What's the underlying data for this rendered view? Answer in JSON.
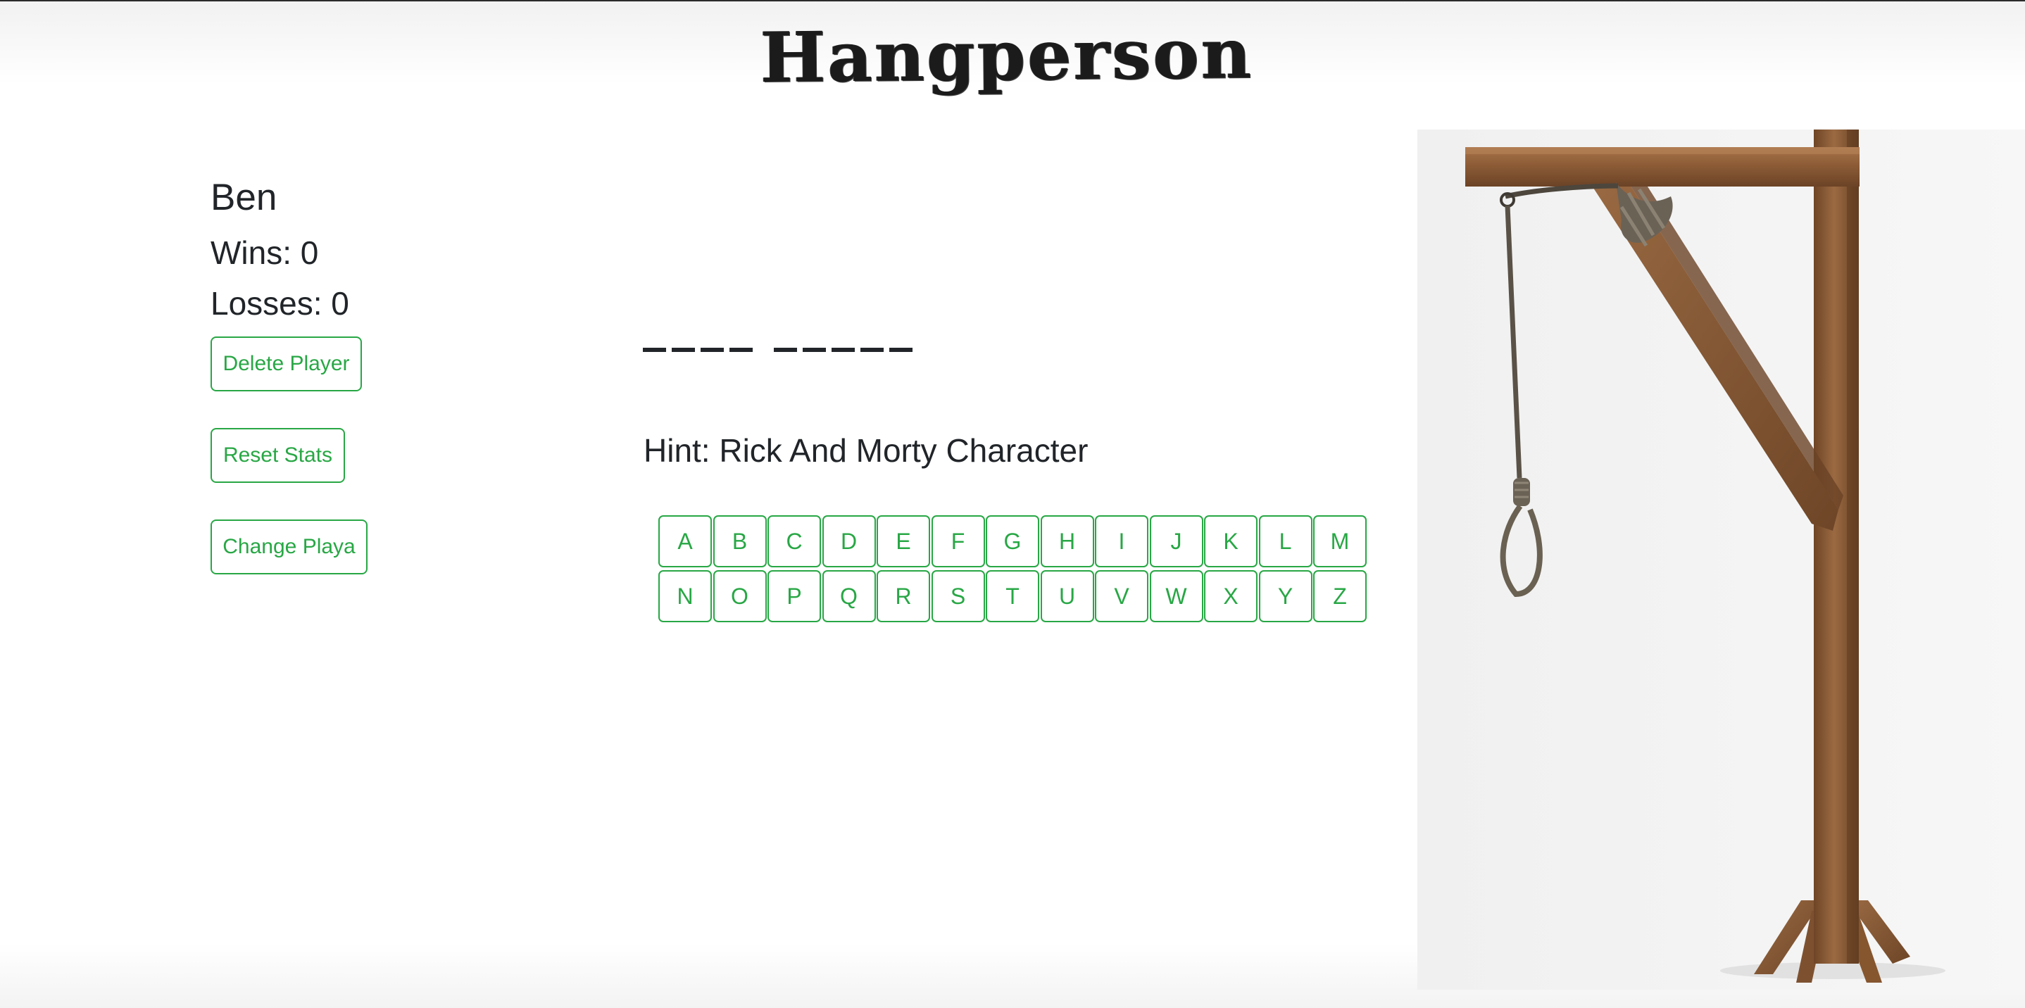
{
  "app": {
    "title": "Hangperson"
  },
  "player": {
    "name": "Ben",
    "wins_label": "Wins: 0",
    "losses_label": "Losses: 0"
  },
  "actions": {
    "delete_label": "Delete Player",
    "reset_label": "Reset Stats",
    "change_label": "Change Playa"
  },
  "puzzle": {
    "word_lengths": [
      4,
      5
    ],
    "hint": "Hint: Rick And Morty Character"
  },
  "keyboard": {
    "letters": [
      "A",
      "B",
      "C",
      "D",
      "E",
      "F",
      "G",
      "H",
      "I",
      "J",
      "K",
      "L",
      "M",
      "N",
      "O",
      "P",
      "Q",
      "R",
      "S",
      "T",
      "U",
      "V",
      "W",
      "X",
      "Y",
      "Z"
    ]
  },
  "colors": {
    "accent": "#28a745",
    "text": "#212529",
    "wood": "#8a5a35"
  },
  "icons": {
    "gallows": "gallows-image"
  }
}
